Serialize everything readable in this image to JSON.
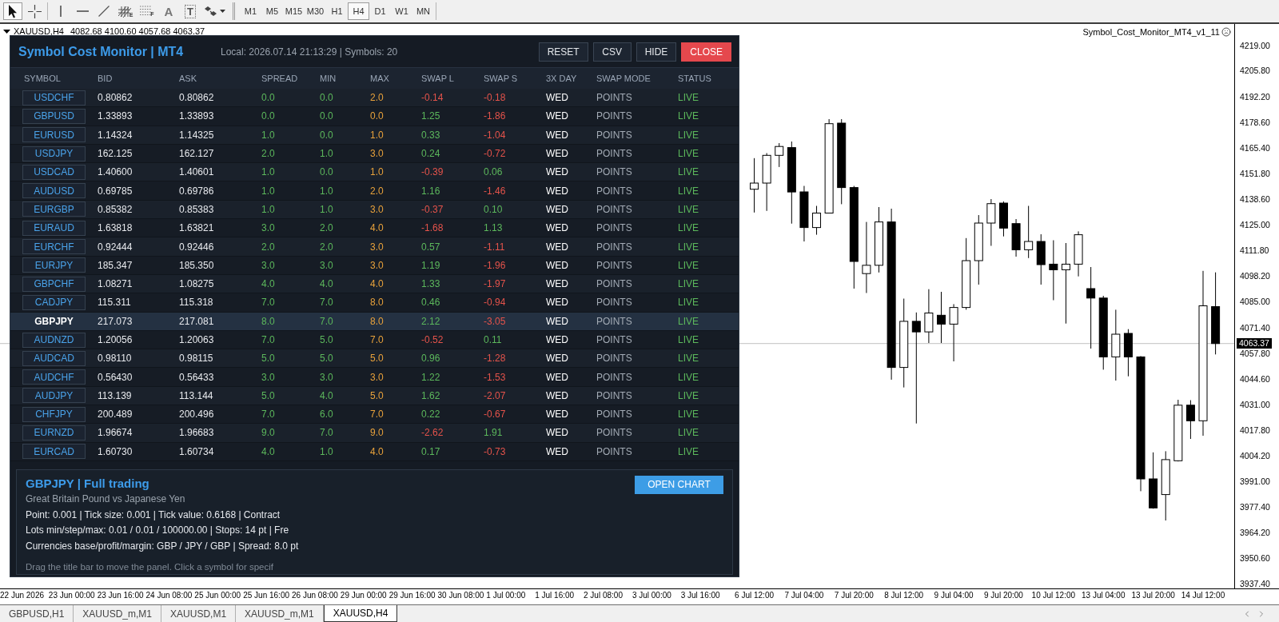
{
  "toolbar": {
    "tool_groups": [
      {
        "tools": [
          {
            "kind": "cursor",
            "selected": true
          },
          {
            "kind": "crosshair",
            "selected": false
          }
        ]
      },
      {
        "tools": [
          {
            "kind": "vline",
            "selected": false
          },
          {
            "kind": "hline",
            "selected": false
          },
          {
            "kind": "trendline",
            "selected": false
          },
          {
            "kind": "channel",
            "glyph": "E",
            "selected": false
          },
          {
            "kind": "fibo",
            "glyph": "F",
            "selected": false
          },
          {
            "kind": "text",
            "glyph": "A",
            "selected": false
          },
          {
            "kind": "label",
            "glyph": "T",
            "selected": false
          },
          {
            "kind": "shapes",
            "selected": false
          }
        ]
      }
    ],
    "periods": [
      {
        "label": "M1",
        "selected": false
      },
      {
        "label": "M5",
        "selected": false
      },
      {
        "label": "M15",
        "selected": false
      },
      {
        "label": "M30",
        "selected": false
      },
      {
        "label": "H1",
        "selected": false
      },
      {
        "label": "H4",
        "selected": true
      },
      {
        "label": "D1",
        "selected": false
      },
      {
        "label": "W1",
        "selected": false
      },
      {
        "label": "MN",
        "selected": false
      }
    ]
  },
  "chart": {
    "symbol": "XAUUSD,H4",
    "header_values": "4082.68 4100.60 4057.68 4063.37",
    "expert": "Symbol_Cost_Monitor_MT4_v1_11",
    "chart_data": {
      "type": "candlestick",
      "categories": [
        "22 Jun 2026",
        null,
        null,
        null,
        "23 Jun 00:00",
        null,
        null,
        null,
        "23 Jun 16:00",
        null,
        null,
        null,
        "24 Jun 08:00",
        null,
        null,
        null,
        "25 Jun 00:00",
        null,
        null,
        null,
        "25 Jun 16:00",
        null,
        null,
        null,
        "26 Jun 08:00",
        null,
        null,
        null,
        "29 Jun 00:00",
        null,
        null,
        null,
        "29 Jun 16:00",
        null,
        null,
        null,
        "30 Jun 08:00",
        null,
        null,
        null,
        "1 Jul 00:00",
        null,
        null,
        null,
        "1 Jul 16:00",
        null,
        null,
        null,
        "2 Jul 08:00",
        null,
        null,
        null,
        "3 Jul 00:00",
        null,
        null,
        null,
        "3 Jul 16:00",
        null,
        null,
        null,
        "6 Jul 12:00",
        null,
        null,
        null,
        "7 Jul 04:00",
        null,
        null,
        null,
        "7 Jul 20:00",
        null,
        null,
        null,
        "8 Jul 12:00",
        null,
        null,
        null,
        "9 Jul 04:00",
        null,
        null,
        null,
        "9 Jul 20:00",
        null,
        null,
        null,
        "10 Jul 12:00",
        null,
        null,
        null,
        "13 Jul 04:00",
        null,
        null,
        null,
        "13 Jul 20:00",
        null,
        null,
        null,
        "14 Jul 12:00",
        null,
        null
      ],
      "ohlc": [
        null,
        null,
        null,
        null,
        null,
        null,
        null,
        null,
        null,
        null,
        null,
        null,
        null,
        null,
        null,
        null,
        null,
        null,
        null,
        null,
        null,
        null,
        null,
        null,
        null,
        null,
        null,
        null,
        null,
        null,
        null,
        null,
        null,
        null,
        null,
        null,
        null,
        null,
        null,
        null,
        null,
        null,
        null,
        null,
        null,
        null,
        null,
        null,
        null,
        null,
        null,
        null,
        null,
        null,
        null,
        null,
        null,
        null,
        null,
        null,
        [
          4144.07,
          4160.33,
          4131.9,
          4147.29
        ],
        [
          4147.29,
          4162.97,
          4132.74,
          4161.8
        ],
        [
          4161.8,
          4168.19,
          4155.69,
          4166.44
        ],
        [
          4165.85,
          4169.03,
          4126.09,
          4142.65
        ],
        [
          4142.69,
          4145.82,
          4116.76,
          4124.04
        ],
        [
          4124.04,
          4135.37,
          4120.28,
          4131.61
        ],
        [
          4131.61,
          4180.74,
          4131.4,
          4178.36
        ],
        [
          4178.65,
          4180.74,
          4136.25,
          4144.95
        ],
        [
          4144.95,
          4145.82,
          4092.1,
          4106.31
        ],
        [
          4099.96,
          4126.97,
          4089.8,
          4104.3
        ],
        [
          4104.3,
          4134.74,
          4100.54,
          4126.97
        ],
        [
          4126.97,
          4133.91,
          4044.47,
          4050.87
        ],
        [
          4050.87,
          4086.87,
          4040.41,
          4074.99
        ],
        [
          4074.99,
          4079.63,
          4021.56,
          4069.47
        ],
        [
          4069.47,
          4091.8,
          4063.66,
          4079.34
        ],
        [
          4078.17,
          4090.42,
          4063.66,
          4073.53
        ],
        [
          4073.53,
          4083.98,
          4054.05,
          4082.23
        ],
        [
          4082.23,
          4118.52,
          4081.06,
          4106.73
        ],
        [
          4106.73,
          4130.56,
          4094.19,
          4126.38
        ],
        [
          4126.38,
          4138.93,
          4114.47,
          4136.54
        ],
        [
          4136.83,
          4137.67,
          4119.4,
          4123.75
        ],
        [
          4126.09,
          4128.47,
          4108.82,
          4112.42
        ],
        [
          4112.42,
          4135.37,
          4108.07,
          4116.76
        ],
        [
          4116.76,
          4120.53,
          4094.19,
          4104.64
        ],
        [
          4104.89,
          4117.39,
          4086.03,
          4101.96
        ],
        [
          4101.96,
          4115.93,
          4073.82,
          4104.89
        ],
        [
          4104.89,
          4122.03,
          4098.49,
          4120.28
        ],
        [
          4092.1,
          4103.38,
          4060.74,
          4087.16
        ],
        [
          4087.16,
          4088.33,
          4049.7,
          4056.39
        ],
        [
          4056.39,
          4081.06,
          4044.01,
          4068.26
        ],
        [
          4068.68,
          4070.9,
          4046.23,
          4056.39
        ],
        [
          4056.39,
          4056.8,
          3986.14,
          3992.58
        ],
        [
          3992.58,
          4006.46,
          3977.0,
          3977.4
        ],
        [
          3984.39,
          4007.05,
          3970.84,
          4002.66
        ],
        [
          4002.07,
          4033.97,
          4001.7,
          4031.13
        ],
        [
          4031.13,
          4033.76,
          4013.49,
          4022.98
        ],
        [
          4022.98,
          4101.38,
          4015.16,
          4083.11
        ],
        [
          4082.68,
          4100.6,
          4057.68,
          4063.37
        ],
        null
      ],
      "ylim": [
        3935.3,
        4230.5
      ],
      "yticks": [
        {
          "value": 4219.0,
          "label": "4219.00"
        },
        {
          "value": 4205.8,
          "label": "4205.80"
        },
        {
          "value": 4192.2,
          "label": "4192.20"
        },
        {
          "value": 4178.6,
          "label": "4178.60"
        },
        {
          "value": 4165.4,
          "label": "4165.40"
        },
        {
          "value": 4151.8,
          "label": "4151.80"
        },
        {
          "value": 4138.6,
          "label": "4138.60"
        },
        {
          "value": 4125.0,
          "label": "4125.00"
        },
        {
          "value": 4111.8,
          "label": "4111.80"
        },
        {
          "value": 4098.2,
          "label": "4098.20"
        },
        {
          "value": 4085.0,
          "label": "4085.00"
        },
        {
          "value": 4071.4,
          "label": "4071.40"
        },
        {
          "value": 4057.8,
          "label": "4057.80"
        },
        {
          "value": 4044.6,
          "label": "4044.60"
        },
        {
          "value": 4031.0,
          "label": "4031.00"
        },
        {
          "value": 4017.8,
          "label": "4017.80"
        },
        {
          "value": 4004.2,
          "label": "4004.20"
        },
        {
          "value": 3991.0,
          "label": "3991.00"
        },
        {
          "value": 3977.4,
          "label": "3977.40"
        },
        {
          "value": 3964.2,
          "label": "3964.20"
        },
        {
          "value": 3950.6,
          "label": "3950.60"
        },
        {
          "value": 3937.4,
          "label": "3937.40"
        }
      ],
      "ref_lines": [
        {
          "axis": "y",
          "value": 4063.37,
          "label": "4063.37"
        }
      ]
    }
  },
  "panel": {
    "title": "Symbol Cost Monitor | MT4",
    "status": "Local: 2026.07.14 21:13:29 | Symbols: 20",
    "buttons": [
      {
        "label": "RESET",
        "kind": "normal"
      },
      {
        "label": "CSV",
        "kind": "normal"
      },
      {
        "label": "HIDE",
        "kind": "normal"
      },
      {
        "label": "CLOSE",
        "kind": "danger"
      }
    ],
    "columns": [
      "SYMBOL",
      "BID",
      "ASK",
      "SPREAD",
      "MIN",
      "MAX",
      "SWAP L",
      "SWAP S",
      "3X DAY",
      "SWAP MODE",
      "STATUS"
    ],
    "rows": [
      {
        "symbol": "USDCHF",
        "bid": "0.80862",
        "ask": "0.80862",
        "spread": "0.0",
        "min": "0.0",
        "max": "2.0",
        "swap_l": {
          "value": "-0.14",
          "negative": true
        },
        "swap_s": {
          "value": "-0.18",
          "negative": true
        },
        "triple_day": "WED",
        "swap_mode": "POINTS",
        "status": "LIVE",
        "selected": false
      },
      {
        "symbol": "GBPUSD",
        "bid": "1.33893",
        "ask": "1.33893",
        "spread": "0.0",
        "min": "0.0",
        "max": "0.0",
        "swap_l": {
          "value": "1.25",
          "negative": false
        },
        "swap_s": {
          "value": "-1.86",
          "negative": true
        },
        "triple_day": "WED",
        "swap_mode": "POINTS",
        "status": "LIVE",
        "selected": false
      },
      {
        "symbol": "EURUSD",
        "bid": "1.14324",
        "ask": "1.14325",
        "spread": "1.0",
        "min": "0.0",
        "max": "1.0",
        "swap_l": {
          "value": "0.33",
          "negative": false
        },
        "swap_s": {
          "value": "-1.04",
          "negative": true
        },
        "triple_day": "WED",
        "swap_mode": "POINTS",
        "status": "LIVE",
        "selected": false
      },
      {
        "symbol": "USDJPY",
        "bid": "162.125",
        "ask": "162.127",
        "spread": "2.0",
        "min": "1.0",
        "max": "3.0",
        "swap_l": {
          "value": "0.24",
          "negative": false
        },
        "swap_s": {
          "value": "-0.72",
          "negative": true
        },
        "triple_day": "WED",
        "swap_mode": "POINTS",
        "status": "LIVE",
        "selected": false
      },
      {
        "symbol": "USDCAD",
        "bid": "1.40600",
        "ask": "1.40601",
        "spread": "1.0",
        "min": "0.0",
        "max": "1.0",
        "swap_l": {
          "value": "-0.39",
          "negative": true
        },
        "swap_s": {
          "value": "0.06",
          "negative": false
        },
        "triple_day": "WED",
        "swap_mode": "POINTS",
        "status": "LIVE",
        "selected": false
      },
      {
        "symbol": "AUDUSD",
        "bid": "0.69785",
        "ask": "0.69786",
        "spread": "1.0",
        "min": "1.0",
        "max": "2.0",
        "swap_l": {
          "value": "1.16",
          "negative": false
        },
        "swap_s": {
          "value": "-1.46",
          "negative": true
        },
        "triple_day": "WED",
        "swap_mode": "POINTS",
        "status": "LIVE",
        "selected": false
      },
      {
        "symbol": "EURGBP",
        "bid": "0.85382",
        "ask": "0.85383",
        "spread": "1.0",
        "min": "1.0",
        "max": "3.0",
        "swap_l": {
          "value": "-0.37",
          "negative": true
        },
        "swap_s": {
          "value": "0.10",
          "negative": false
        },
        "triple_day": "WED",
        "swap_mode": "POINTS",
        "status": "LIVE",
        "selected": false
      },
      {
        "symbol": "EURAUD",
        "bid": "1.63818",
        "ask": "1.63821",
        "spread": "3.0",
        "min": "2.0",
        "max": "4.0",
        "swap_l": {
          "value": "-1.68",
          "negative": true
        },
        "swap_s": {
          "value": "1.13",
          "negative": false
        },
        "triple_day": "WED",
        "swap_mode": "POINTS",
        "status": "LIVE",
        "selected": false
      },
      {
        "symbol": "EURCHF",
        "bid": "0.92444",
        "ask": "0.92446",
        "spread": "2.0",
        "min": "2.0",
        "max": "3.0",
        "swap_l": {
          "value": "0.57",
          "negative": false
        },
        "swap_s": {
          "value": "-1.11",
          "negative": true
        },
        "triple_day": "WED",
        "swap_mode": "POINTS",
        "status": "LIVE",
        "selected": false
      },
      {
        "symbol": "EURJPY",
        "bid": "185.347",
        "ask": "185.350",
        "spread": "3.0",
        "min": "3.0",
        "max": "3.0",
        "swap_l": {
          "value": "1.19",
          "negative": false
        },
        "swap_s": {
          "value": "-1.96",
          "negative": true
        },
        "triple_day": "WED",
        "swap_mode": "POINTS",
        "status": "LIVE",
        "selected": false
      },
      {
        "symbol": "GBPCHF",
        "bid": "1.08271",
        "ask": "1.08275",
        "spread": "4.0",
        "min": "4.0",
        "max": "4.0",
        "swap_l": {
          "value": "1.33",
          "negative": false
        },
        "swap_s": {
          "value": "-1.97",
          "negative": true
        },
        "triple_day": "WED",
        "swap_mode": "POINTS",
        "status": "LIVE",
        "selected": false
      },
      {
        "symbol": "CADJPY",
        "bid": "115.311",
        "ask": "115.318",
        "spread": "7.0",
        "min": "7.0",
        "max": "8.0",
        "swap_l": {
          "value": "0.46",
          "negative": false
        },
        "swap_s": {
          "value": "-0.94",
          "negative": true
        },
        "triple_day": "WED",
        "swap_mode": "POINTS",
        "status": "LIVE",
        "selected": false
      },
      {
        "symbol": "GBPJPY",
        "bid": "217.073",
        "ask": "217.081",
        "spread": "8.0",
        "min": "7.0",
        "max": "8.0",
        "swap_l": {
          "value": "2.12",
          "negative": false
        },
        "swap_s": {
          "value": "-3.05",
          "negative": true
        },
        "triple_day": "WED",
        "swap_mode": "POINTS",
        "status": "LIVE",
        "selected": true
      },
      {
        "symbol": "AUDNZD",
        "bid": "1.20056",
        "ask": "1.20063",
        "spread": "7.0",
        "min": "5.0",
        "max": "7.0",
        "swap_l": {
          "value": "-0.52",
          "negative": true
        },
        "swap_s": {
          "value": "0.11",
          "negative": false
        },
        "triple_day": "WED",
        "swap_mode": "POINTS",
        "status": "LIVE",
        "selected": false
      },
      {
        "symbol": "AUDCAD",
        "bid": "0.98110",
        "ask": "0.98115",
        "spread": "5.0",
        "min": "5.0",
        "max": "5.0",
        "swap_l": {
          "value": "0.96",
          "negative": false
        },
        "swap_s": {
          "value": "-1.28",
          "negative": true
        },
        "triple_day": "WED",
        "swap_mode": "POINTS",
        "status": "LIVE",
        "selected": false
      },
      {
        "symbol": "AUDCHF",
        "bid": "0.56430",
        "ask": "0.56433",
        "spread": "3.0",
        "min": "3.0",
        "max": "3.0",
        "swap_l": {
          "value": "1.22",
          "negative": false
        },
        "swap_s": {
          "value": "-1.53",
          "negative": true
        },
        "triple_day": "WED",
        "swap_mode": "POINTS",
        "status": "LIVE",
        "selected": false
      },
      {
        "symbol": "AUDJPY",
        "bid": "113.139",
        "ask": "113.144",
        "spread": "5.0",
        "min": "4.0",
        "max": "5.0",
        "swap_l": {
          "value": "1.62",
          "negative": false
        },
        "swap_s": {
          "value": "-2.07",
          "negative": true
        },
        "triple_day": "WED",
        "swap_mode": "POINTS",
        "status": "LIVE",
        "selected": false
      },
      {
        "symbol": "CHFJPY",
        "bid": "200.489",
        "ask": "200.496",
        "spread": "7.0",
        "min": "6.0",
        "max": "7.0",
        "swap_l": {
          "value": "0.22",
          "negative": false
        },
        "swap_s": {
          "value": "-0.67",
          "negative": true
        },
        "triple_day": "WED",
        "swap_mode": "POINTS",
        "status": "LIVE",
        "selected": false
      },
      {
        "symbol": "EURNZD",
        "bid": "1.96674",
        "ask": "1.96683",
        "spread": "9.0",
        "min": "7.0",
        "max": "9.0",
        "swap_l": {
          "value": "-2.62",
          "negative": true
        },
        "swap_s": {
          "value": "1.91",
          "negative": false
        },
        "triple_day": "WED",
        "swap_mode": "POINTS",
        "status": "LIVE",
        "selected": false
      },
      {
        "symbol": "EURCAD",
        "bid": "1.60730",
        "ask": "1.60734",
        "spread": "4.0",
        "min": "1.0",
        "max": "4.0",
        "swap_l": {
          "value": "0.17",
          "negative": false
        },
        "swap_s": {
          "value": "-0.73",
          "negative": true
        },
        "triple_day": "WED",
        "swap_mode": "POINTS",
        "status": "LIVE",
        "selected": false
      }
    ],
    "info": {
      "title": "GBPJPY | Full trading",
      "subtitle": "Great Britain Pound vs Japanese Yen",
      "lines": [
        "Point: 0.001 | Tick size: 0.001 | Tick value: 0.6168 | Contract",
        "Lots min/step/max: 0.01 / 0.01 / 100000.00 | Stops: 14 pt | Fre",
        "Currencies base/profit/margin: GBP / JPY / GBP | Spread: 8.0 pt"
      ],
      "hint": "Drag the title bar to move the panel. Click a symbol for specif",
      "button": "OPEN CHART"
    }
  },
  "tabs": [
    {
      "label": "GBPUSD,H1",
      "selected": false
    },
    {
      "label": "XAUUSD_m,M1",
      "selected": false
    },
    {
      "label": "XAUUSD,M1",
      "selected": false
    },
    {
      "label": "XAUUSD_m,M1",
      "selected": false
    },
    {
      "label": "XAUUSD,H4",
      "selected": true
    }
  ]
}
